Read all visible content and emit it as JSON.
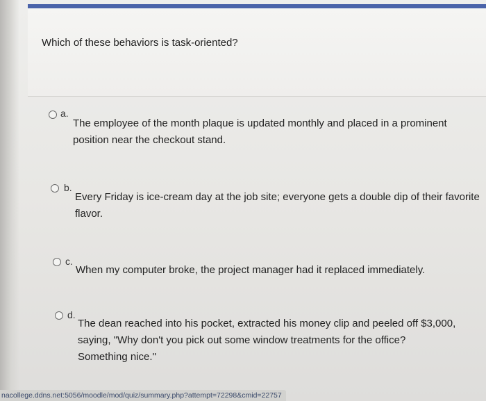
{
  "question": {
    "text": "Which of these behaviors is task-oriented?"
  },
  "options": [
    {
      "letter": "a.",
      "text": "The employee of the month plaque is updated monthly and placed in a prominent position near the checkout stand."
    },
    {
      "letter": "b.",
      "text": "Every Friday is ice-cream day at the job site; everyone gets a double dip of their favorite flavor."
    },
    {
      "letter": "c.",
      "text": "When my computer broke, the project manager had it replaced immediately."
    },
    {
      "letter": "d.",
      "text": "The dean reached into his pocket, extracted his money clip and peeled off $3,000, saying, \"Why don't you pick out some window treatments for the office? Something nice.\""
    }
  ],
  "status_bar": {
    "url": "nacollege.ddns.net:5056/moodle/mod/quiz/summary.php?attempt=72298&cmid=22757"
  },
  "colors": {
    "accent_bar": "#4a63a9",
    "background": "#e9e8e5"
  }
}
